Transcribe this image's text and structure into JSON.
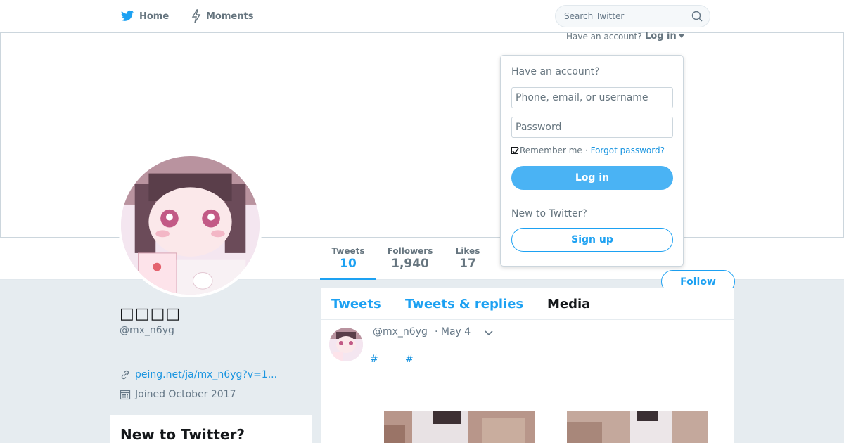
{
  "nav": {
    "home_label": "Home",
    "moments_label": "Moments",
    "search_placeholder": "Search Twitter"
  },
  "account": {
    "prompt": "Have an account?",
    "login_label": "Log in"
  },
  "stats": {
    "tweets_label": "Tweets",
    "tweets_value": "10",
    "followers_label": "Followers",
    "followers_value": "1,940",
    "likes_label": "Likes",
    "likes_value": "17"
  },
  "follow_label": "Follow",
  "login_dropdown": {
    "title": "Have an account?",
    "username_placeholder": "Phone, email, or username",
    "password_placeholder": "Password",
    "remember_label": "Remember me",
    "separator": "·",
    "forgot_label": "Forgot password?",
    "login_button": "Log in",
    "new_label": "New to Twitter?",
    "signup_button": "Sign up"
  },
  "profile": {
    "name": "□□□□",
    "handle": "@mx_n6yg",
    "link": "peing.net/ja/mx_n6yg?v=1...",
    "joined": "Joined October 2017"
  },
  "signup_card": {
    "title": "New to Twitter?"
  },
  "timeline": {
    "tabs": [
      "Tweets",
      "Tweets & replies",
      "Media"
    ],
    "tweet": {
      "handle": "@mx_n6yg",
      "date": "· May 4",
      "tags": [
        "#",
        "#"
      ]
    }
  },
  "colors": {
    "accent": "#1da1f2",
    "link": "#1b95e0",
    "muted": "#657786",
    "background": "#e6ecf0"
  },
  "icons": {
    "home": "twitter-bird-icon",
    "moments": "lightning-icon",
    "search": "magnifier-icon",
    "link": "link-icon",
    "calendar": "calendar-icon",
    "caret": "chevron-down-icon"
  }
}
